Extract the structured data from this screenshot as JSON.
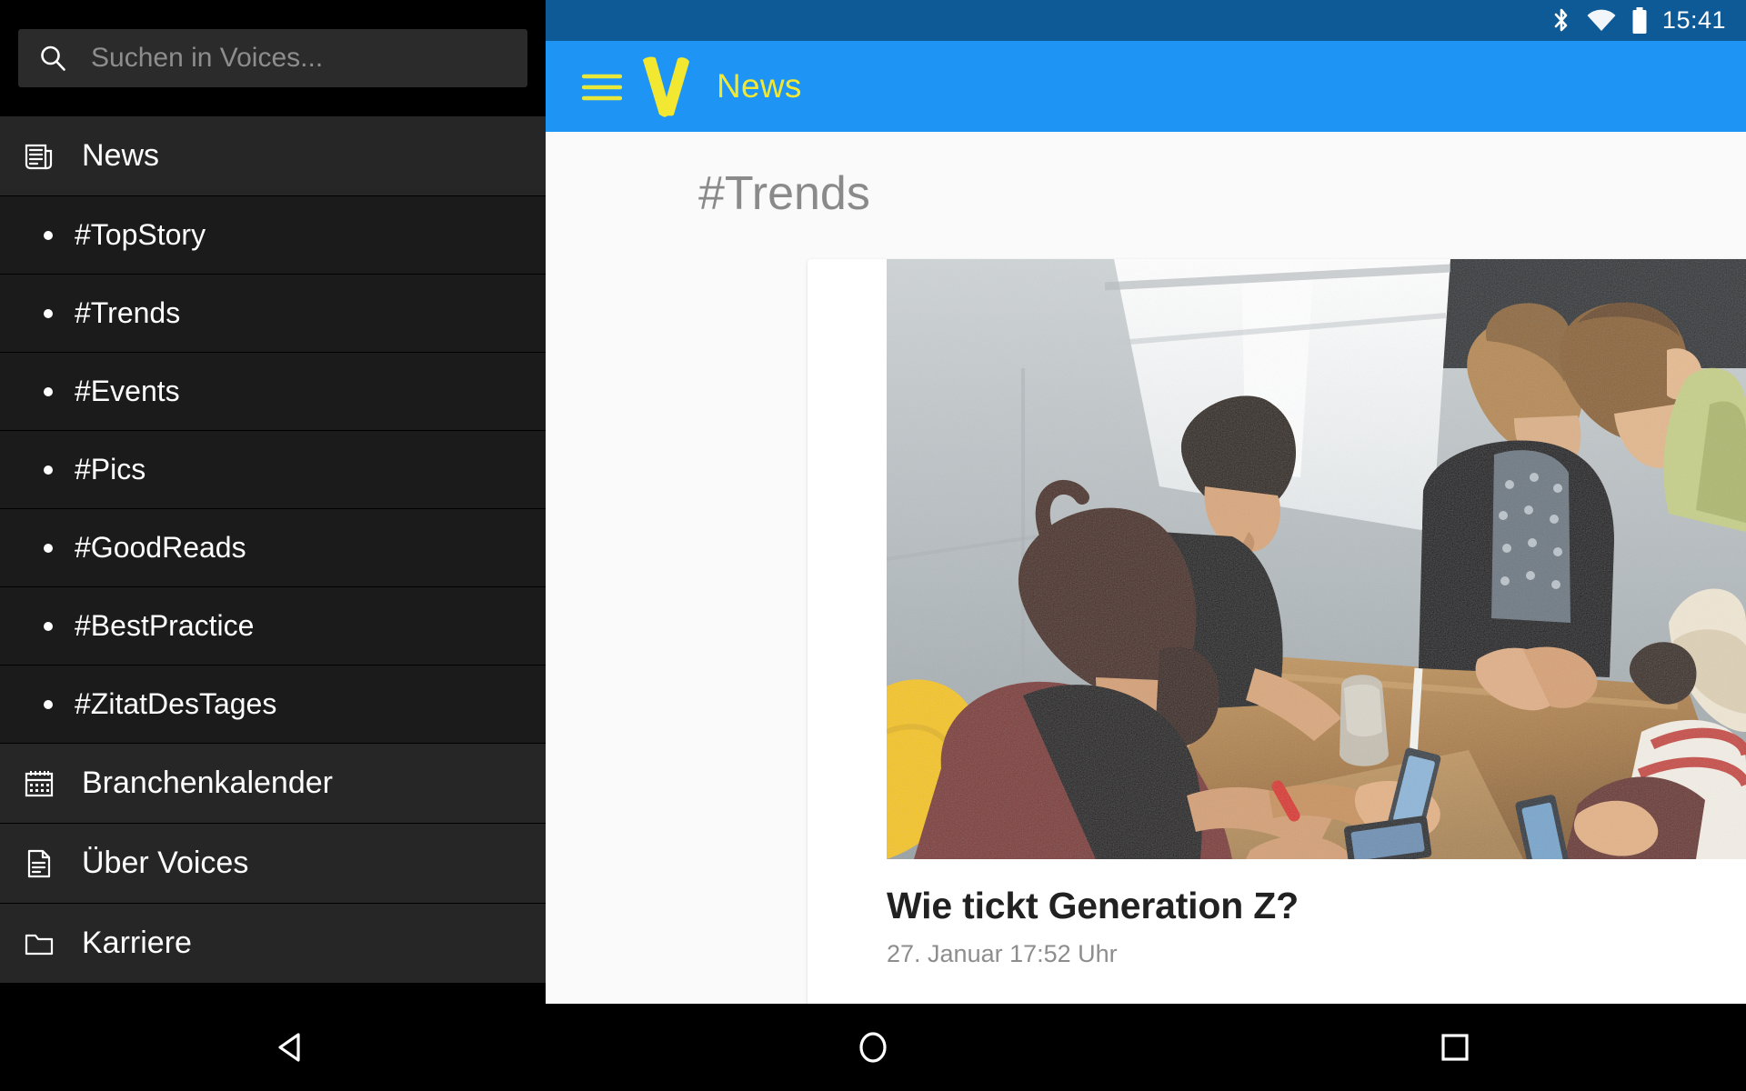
{
  "status_bar": {
    "time": "15:41",
    "icons": [
      "bluetooth-icon",
      "wifi-icon",
      "battery-icon"
    ],
    "background": "#0d5a96"
  },
  "app_bar": {
    "menu_icon": "hamburger-menu-icon",
    "logo": "voices-v-logo",
    "title": "News",
    "background": "#1e95f5",
    "accent": "#f2e832"
  },
  "drawer": {
    "search": {
      "placeholder": "Suchen in Voices...",
      "value": "",
      "icon": "search-icon"
    },
    "sections": [
      {
        "icon": "newspaper-icon",
        "label": "News",
        "selected": true,
        "children": [
          {
            "label": "#TopStory"
          },
          {
            "label": "#Trends"
          },
          {
            "label": "#Events"
          },
          {
            "label": "#Pics"
          },
          {
            "label": "#GoodReads"
          },
          {
            "label": "#BestPractice"
          },
          {
            "label": "#ZitatDesTages"
          }
        ]
      },
      {
        "icon": "calendar-icon",
        "label": "Branchenkalender",
        "children": []
      },
      {
        "icon": "document-icon",
        "label": "Über Voices",
        "children": []
      },
      {
        "icon": "folder-icon",
        "label": "Karriere",
        "children": []
      }
    ]
  },
  "content": {
    "heading": "#Trends",
    "card": {
      "image_alt": "group-of-young-people-around-table-with-smartphones",
      "title": "Wie tickt Generation Z?",
      "date": "27. Januar 17:52 Uhr"
    },
    "background": "#fafafa"
  },
  "system_nav": {
    "back": "back-triangle-icon",
    "home": "home-circle-icon",
    "recents": "recents-square-icon"
  }
}
